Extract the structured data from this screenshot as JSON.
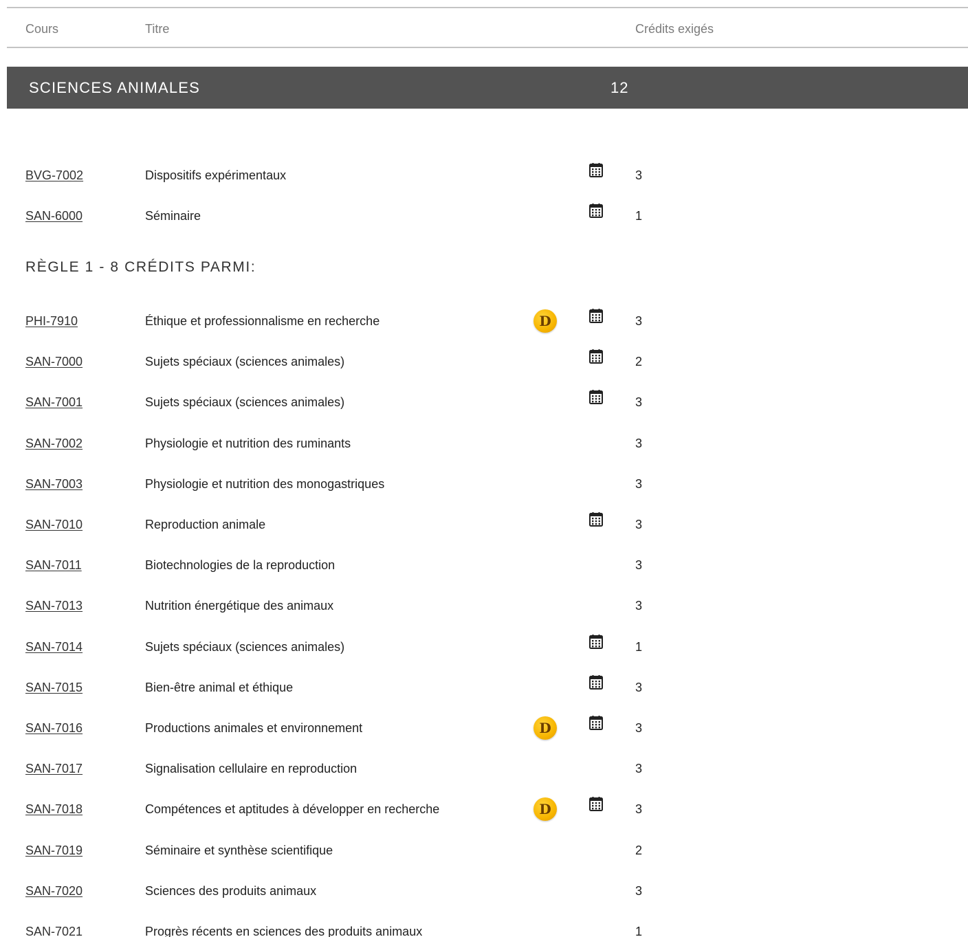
{
  "header": {
    "course_label": "Cours",
    "title_label": "Titre",
    "credits_label": "Crédits exigés"
  },
  "section": {
    "title": "SCIENCES ANIMALES",
    "credits": "12"
  },
  "rule": {
    "heading": "RÈGLE 1 - 8 CRÉDITS PARMI:"
  },
  "required_courses": [
    {
      "code": "BVG-7002",
      "title": "Dispositifs expérimentaux",
      "credits": "3",
      "distance": false,
      "schedule": true
    },
    {
      "code": "SAN-6000",
      "title": "Séminaire",
      "credits": "1",
      "distance": false,
      "schedule": true
    }
  ],
  "rule_courses": [
    {
      "code": "PHI-7910",
      "title": "Éthique et professionnalisme en recherche",
      "credits": "3",
      "distance": true,
      "schedule": true
    },
    {
      "code": "SAN-7000",
      "title": "Sujets spéciaux (sciences animales)",
      "credits": "2",
      "distance": false,
      "schedule": true
    },
    {
      "code": "SAN-7001",
      "title": "Sujets spéciaux (sciences animales)",
      "credits": "3",
      "distance": false,
      "schedule": true
    },
    {
      "code": "SAN-7002",
      "title": "Physiologie et nutrition des ruminants",
      "credits": "3",
      "distance": false,
      "schedule": false
    },
    {
      "code": "SAN-7003",
      "title": "Physiologie et nutrition des monogastriques",
      "credits": "3",
      "distance": false,
      "schedule": false
    },
    {
      "code": "SAN-7010",
      "title": "Reproduction animale",
      "credits": "3",
      "distance": false,
      "schedule": true
    },
    {
      "code": "SAN-7011",
      "title": "Biotechnologies de la reproduction",
      "credits": "3",
      "distance": false,
      "schedule": false
    },
    {
      "code": "SAN-7013",
      "title": "Nutrition énergétique des animaux",
      "credits": "3",
      "distance": false,
      "schedule": false
    },
    {
      "code": "SAN-7014",
      "title": "Sujets spéciaux (sciences animales)",
      "credits": "1",
      "distance": false,
      "schedule": true
    },
    {
      "code": "SAN-7015",
      "title": "Bien-être animal et éthique",
      "credits": "3",
      "distance": false,
      "schedule": true
    },
    {
      "code": "SAN-7016",
      "title": "Productions animales et environnement",
      "credits": "3",
      "distance": true,
      "schedule": true
    },
    {
      "code": "SAN-7017",
      "title": "Signalisation cellulaire en reproduction",
      "credits": "3",
      "distance": false,
      "schedule": false
    },
    {
      "code": "SAN-7018",
      "title": "Compétences et aptitudes à développer en recherche",
      "credits": "3",
      "distance": true,
      "schedule": true
    },
    {
      "code": "SAN-7019",
      "title": "Séminaire et synthèse scientifique",
      "credits": "2",
      "distance": false,
      "schedule": false
    },
    {
      "code": "SAN-7020",
      "title": "Sciences des produits animaux",
      "credits": "3",
      "distance": false,
      "schedule": false
    },
    {
      "code": "SAN-7021",
      "title": "Progrès récents en sciences des produits animaux",
      "credits": "1",
      "distance": false,
      "schedule": false
    }
  ],
  "icons": {
    "distance_badge": "D",
    "distance_icon": "distance-education-icon",
    "schedule_icon": "calendar-icon"
  },
  "colors": {
    "section_bar": "#535353",
    "badge": "#f7b500",
    "header_rule": "#c4c4c4"
  }
}
